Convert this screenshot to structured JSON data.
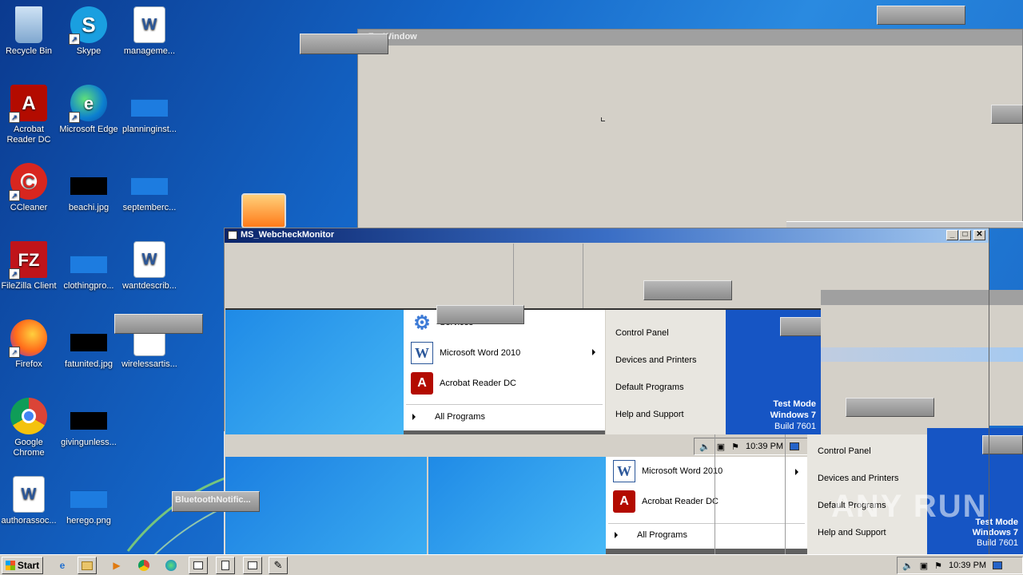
{
  "desktop": {
    "icons": [
      {
        "label": "Recycle Bin",
        "glyph": "🗑"
      },
      {
        "label": "Skype",
        "glyph": "S"
      },
      {
        "label": "manageme...",
        "glyph": "W"
      },
      {
        "label": "Acrobat Reader DC",
        "glyph": "A"
      },
      {
        "label": "Microsoft Edge",
        "glyph": "e"
      },
      {
        "label": "planninginst...",
        "glyph": ""
      },
      {
        "label": "CCleaner",
        "glyph": "C"
      },
      {
        "label": "beachi.jpg",
        "glyph": ""
      },
      {
        "label": "septemberc...",
        "glyph": ""
      },
      {
        "label": "FileZilla Client",
        "glyph": "FZ"
      },
      {
        "label": "clothingpro...",
        "glyph": ""
      },
      {
        "label": "wantdescrib...",
        "glyph": "W"
      },
      {
        "label": "Firefox",
        "glyph": "🦊"
      },
      {
        "label": "fatunited.jpg",
        "glyph": ""
      },
      {
        "label": "wirelessartis...",
        "glyph": ""
      },
      {
        "label": "Google Chrome",
        "glyph": ""
      },
      {
        "label": "givingunless...",
        "glyph": ""
      },
      {
        "label": "authorassoc...",
        "glyph": "W"
      },
      {
        "label": "herego.png",
        "glyph": ""
      }
    ]
  },
  "windows": {
    "fax_title": "nFaxWindow",
    "webcheck_title": "MS_WebcheckMonitor",
    "minimize": "_",
    "maximize": "□",
    "close": "✕",
    "bluetooth_label": "BluetoothNotific..."
  },
  "start_menu": {
    "services": "Services",
    "word": "Microsoft Word 2010",
    "acrobat": "Acrobat Reader DC",
    "all_programs": "All Programs",
    "control_panel": "Control Panel",
    "devices": "Devices and Printers",
    "default_programs": "Default Programs",
    "help": "Help and Support",
    "test_mode": "Test Mode",
    "windows7": "Windows 7",
    "build": "Build 7601",
    "time": "10:39 PM"
  },
  "taskbar": {
    "start_label": "Start",
    "time": "10:39 PM"
  },
  "watermark": "ANY RUN",
  "colors": {
    "win_face": "#d4d0c8",
    "title_blue": "#0a246a",
    "brand_panel": "#1655c4"
  }
}
